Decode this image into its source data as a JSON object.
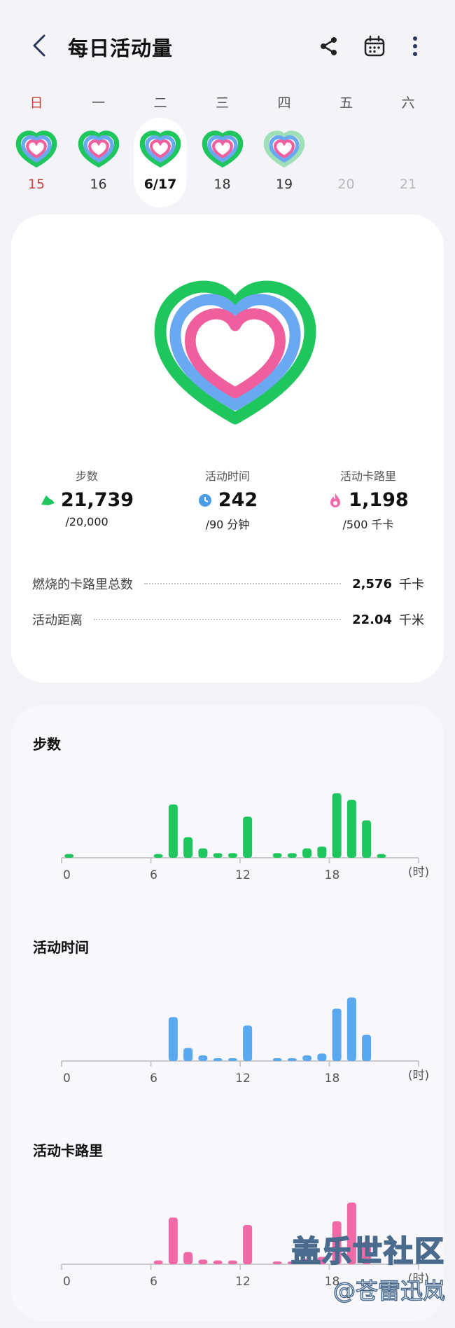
{
  "header": {
    "title": "每日活动量",
    "icons": [
      "back-arrow-icon",
      "share-icon",
      "calendar-icon",
      "more-vertical-icon"
    ]
  },
  "week": [
    {
      "name": "日",
      "num": "15",
      "ring": true,
      "state": "sunday"
    },
    {
      "name": "一",
      "num": "16",
      "ring": true,
      "state": "normal"
    },
    {
      "name": "二",
      "num": "6/17",
      "ring": true,
      "state": "selected"
    },
    {
      "name": "三",
      "num": "18",
      "ring": true,
      "state": "normal"
    },
    {
      "name": "四",
      "num": "19",
      "ring": true,
      "state": "partial"
    },
    {
      "name": "五",
      "num": "20",
      "ring": false,
      "state": "future"
    },
    {
      "name": "六",
      "num": "21",
      "ring": false,
      "state": "future"
    }
  ],
  "colors": {
    "steps": "#1fc65e",
    "active_time": "#5aa8f0",
    "calories": "#f06aa8",
    "sunday": "#c8443c"
  },
  "summary": {
    "stats": [
      {
        "label": "步数",
        "value": "21,739",
        "goal": "/20,000",
        "icon": "shoe-icon",
        "color": "#1fc65e"
      },
      {
        "label": "活动时间",
        "value": "242",
        "goal": "/90 分钟",
        "icon": "clock-icon",
        "color": "#4a9ee8"
      },
      {
        "label": "活动卡路里",
        "value": "1,198",
        "goal": "/500 千卡",
        "icon": "flame-icon",
        "color": "#f06aa8"
      }
    ],
    "rows": [
      {
        "label": "燃烧的卡路里总数",
        "value": "2,576",
        "unit": "千卡"
      },
      {
        "label": "活动距离",
        "value": "22.04",
        "unit": "千米"
      }
    ]
  },
  "charts": {
    "x_ticks": [
      "0",
      "6",
      "12",
      "18"
    ],
    "x_unit": "(时)",
    "steps": {
      "title": "步数"
    },
    "active_time": {
      "title": "活动时间"
    },
    "calories": {
      "title": "活动卡路里"
    }
  },
  "chart_data": [
    {
      "type": "bar",
      "title": "步数",
      "x": [
        0,
        1,
        2,
        3,
        4,
        5,
        6,
        7,
        8,
        9,
        10,
        11,
        12,
        13,
        14,
        15,
        16,
        17,
        18,
        19,
        20,
        21,
        22,
        23
      ],
      "values": [
        4,
        0,
        0,
        0,
        0,
        0,
        4,
        57,
        22,
        10,
        5,
        5,
        44,
        0,
        5,
        5,
        10,
        12,
        69,
        62,
        40,
        4,
        0,
        0
      ],
      "xlabel": "(时)",
      "color": "#1fc65e"
    },
    {
      "type": "bar",
      "title": "活动时间",
      "x": [
        0,
        1,
        2,
        3,
        4,
        5,
        6,
        7,
        8,
        9,
        10,
        11,
        12,
        13,
        14,
        15,
        16,
        17,
        18,
        19,
        20,
        21,
        22,
        23
      ],
      "values": [
        0,
        0,
        0,
        0,
        0,
        0,
        0,
        47,
        14,
        6,
        3,
        3,
        38,
        0,
        3,
        3,
        6,
        8,
        56,
        68,
        28,
        0,
        0,
        0
      ],
      "xlabel": "(时)",
      "color": "#5aa8f0"
    },
    {
      "type": "bar",
      "title": "活动卡路里",
      "x": [
        0,
        1,
        2,
        3,
        4,
        5,
        6,
        7,
        8,
        9,
        10,
        11,
        12,
        13,
        14,
        15,
        16,
        17,
        18,
        19,
        20,
        21,
        22,
        23
      ],
      "values": [
        0,
        0,
        0,
        0,
        0,
        0,
        4,
        50,
        13,
        5,
        4,
        4,
        42,
        0,
        3,
        3,
        6,
        8,
        46,
        66,
        24,
        0,
        0,
        0
      ],
      "xlabel": "(时)",
      "color": "#f06aa8"
    }
  ],
  "watermark": {
    "line1": "盖乐世社区",
    "line2": "@苍雷迅岚"
  }
}
